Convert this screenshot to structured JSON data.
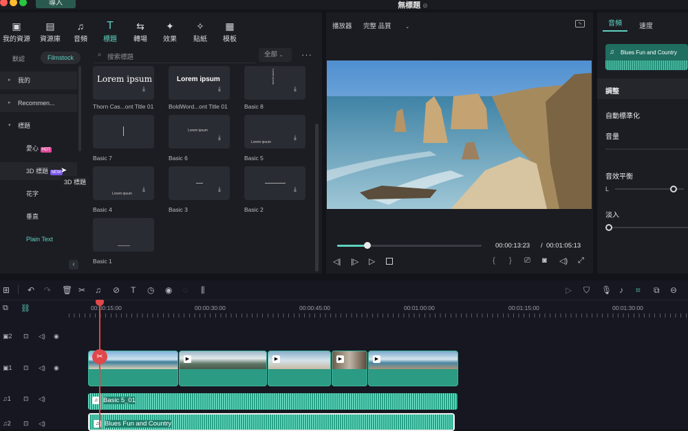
{
  "window": {
    "title": "無標題",
    "import_tab": "導入"
  },
  "toolbar": [
    {
      "label": "我的資源",
      "icon": "image-icon"
    },
    {
      "label": "資源庫",
      "icon": "library-icon"
    },
    {
      "label": "音頻",
      "icon": "music-icon"
    },
    {
      "label": "標題",
      "icon": "text-icon"
    },
    {
      "label": "轉場",
      "icon": "transition-icon"
    },
    {
      "label": "效果",
      "icon": "effects-icon"
    },
    {
      "label": "貼紙",
      "icon": "sticker-icon"
    },
    {
      "label": "模板",
      "icon": "template-icon"
    }
  ],
  "subtabs": {
    "default": "默認",
    "filmstock": "Filmstock"
  },
  "search": {
    "placeholder": "搜索標題",
    "filter": "全部"
  },
  "categories": [
    {
      "label": "我的",
      "arrow": "▸"
    },
    {
      "label": "Recommen...",
      "arrow": "▸"
    },
    {
      "label": "標題",
      "arrow": "▾"
    },
    {
      "label": "愛心",
      "badge": "HOT"
    },
    {
      "label": "3D 標題",
      "badge": "NEW"
    },
    {
      "label": "花字"
    },
    {
      "label": "垂直"
    },
    {
      "label": "Plain Text"
    }
  ],
  "tooltip": "3D 標題",
  "cards": [
    {
      "label": "Thorn Cas...ont Title 01",
      "preview": "Lorem ipsum"
    },
    {
      "label": "BoldWord...ont Title 01",
      "preview": "Lorem ipsum"
    },
    {
      "label": "Basic 8",
      "preview": "Lorem ipsum"
    },
    {
      "label": "Basic 7",
      "preview": ""
    },
    {
      "label": "Basic 6",
      "preview": "Lorem ipsum"
    },
    {
      "label": "Basic 5",
      "preview": "Lorem ipsum"
    },
    {
      "label": "Basic 4",
      "preview": "Lorem ipsum"
    },
    {
      "label": "Basic 3",
      "preview": ""
    },
    {
      "label": "Basic 2",
      "preview": ""
    },
    {
      "label": "Basic 1",
      "preview": ""
    }
  ],
  "player": {
    "label": "播放器",
    "quality": "完整 品質",
    "current": "00:00:13:23",
    "separator": "/",
    "total": "00:01:05:13",
    "progress": 0.21
  },
  "right": {
    "tab_audio": "音頻",
    "tab_speed": "速度",
    "track_name": "Blues Fun and Country",
    "adjust": "調整",
    "auto_normalize": "自動標準化",
    "volume": "音量",
    "balance": "音效平衡",
    "balance_l": "L",
    "fade_in": "淡入"
  },
  "ruler": [
    "00:00:15:00",
    "00:00:30:00",
    "00:00:45:00",
    "00:01:00:00",
    "00:01:15:00",
    "00:01:30:00"
  ],
  "tracks": [
    {
      "id": "2"
    },
    {
      "id": "1"
    },
    {
      "id": "1",
      "audio": true
    },
    {
      "id": "2",
      "audio": true
    }
  ],
  "audio_clips": {
    "a1": "Basic 5_01",
    "a2": "Blues Fun and Country"
  }
}
